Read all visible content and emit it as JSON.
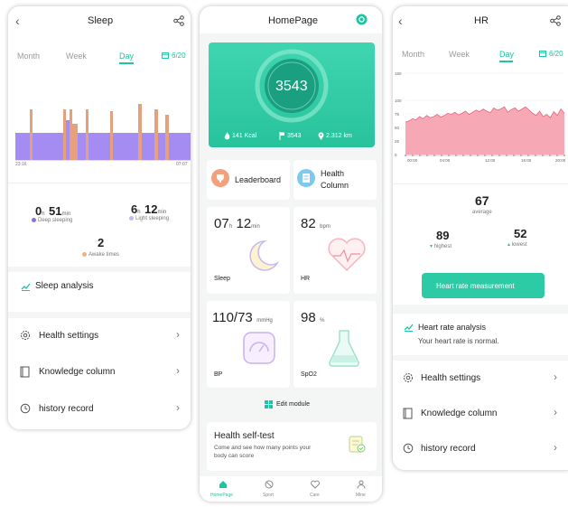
{
  "colors": {
    "accent": "#1fc4a0",
    "sleep_deep": "#a58cf2",
    "sleep_light": "#e5a17b",
    "hr_fill": "#f49aa8",
    "hr_line": "#e8647a"
  },
  "sleep": {
    "title": "Sleep",
    "tabs": [
      "Month",
      "Week",
      "Day"
    ],
    "active_tab": "Day",
    "date": "6/20",
    "time_start": "23:16",
    "time_end": "07:07",
    "deep": {
      "hours": "0",
      "h_unit": "h",
      "minutes": "51",
      "m_unit": "min",
      "label": "Deep sleeping"
    },
    "light": {
      "hours": "6",
      "h_unit": "h",
      "minutes": "12",
      "m_unit": "min",
      "label": "Light sleeping"
    },
    "awake": {
      "count": "2",
      "label": "Awake times"
    },
    "analysis": "Sleep analysis",
    "menu": [
      "Health settings",
      "Knowledge column",
      "history record"
    ]
  },
  "home": {
    "title": "HomePage",
    "steps": "3543",
    "kcal": "141 Kcal",
    "step_count": "3543",
    "distance": "2.312 km",
    "leaderboard": "Leaderboard",
    "health_column_1": "Health",
    "health_column_2": "Column",
    "sleep_module": {
      "hours": "07",
      "h_unit": "h",
      "minutes": "12",
      "m_unit": "min",
      "label": "Sleep"
    },
    "hr_module": {
      "value": "82",
      "unit": "bpm",
      "label": "HR"
    },
    "bp_module": {
      "value": "110/73",
      "unit": "mmHg",
      "label": "BP"
    },
    "spo2_module": {
      "value": "98",
      "unit": "%",
      "label": "SpO2"
    },
    "edit_module": "Edit module",
    "self_test": {
      "title": "Health self-test",
      "desc1": "Come and see how many points your",
      "desc2": "body can score"
    },
    "nav": [
      "HomePage",
      "Sport",
      "Care",
      "Mine"
    ],
    "active_nav": "HomePage"
  },
  "hr": {
    "title": "HR",
    "tabs": [
      "Month",
      "Week",
      "Day"
    ],
    "active_tab": "Day",
    "date": "6/20",
    "y_ticks": [
      "150",
      "100",
      "75",
      "50",
      "25",
      "0"
    ],
    "x_ticks": [
      "00:00",
      "04:00",
      "12:00",
      "16:00",
      "20:00"
    ],
    "average": {
      "value": "67",
      "label": "average"
    },
    "highest": {
      "value": "89",
      "label": "highest"
    },
    "lowest": {
      "value": "52",
      "label": "lowest"
    },
    "measure_button": "Heart rate measurement",
    "analysis_title": "Heart rate analysis",
    "analysis_text": "Your heart rate is normal.",
    "menu": [
      "Health settings",
      "Knowledge column",
      "history record"
    ]
  },
  "chart_data": [
    {
      "type": "bar",
      "title": "",
      "description_source": "sleep timeline",
      "x": [
        "23:16",
        "07:07"
      ],
      "series": [
        {
          "name": "Deep sleeping",
          "color": "#a58cf2"
        },
        {
          "name": "Light sleeping",
          "color": "#e5a17b"
        }
      ]
    },
    {
      "type": "area",
      "title": "",
      "xlabel": "",
      "ylabel": "",
      "x_ticks": [
        "00:00",
        "04:00",
        "12:00",
        "16:00",
        "20:00"
      ],
      "ylim": [
        0,
        150
      ],
      "grid": true,
      "values": [
        60,
        62,
        66,
        64,
        70,
        66,
        72,
        68,
        70,
        74,
        69,
        72,
        76,
        74,
        78,
        73,
        76,
        80,
        74,
        78,
        82,
        79,
        84,
        80,
        77,
        86,
        82,
        84,
        88,
        78,
        83,
        86,
        80,
        84,
        88,
        82,
        76,
        72,
        80,
        70,
        74,
        68,
        79,
        72,
        84,
        76
      ]
    }
  ]
}
